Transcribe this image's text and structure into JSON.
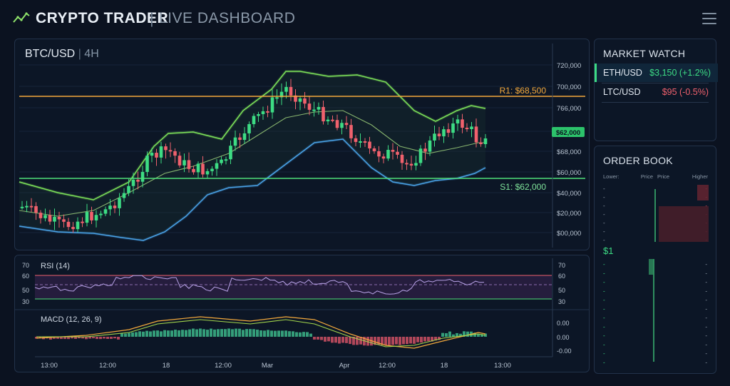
{
  "header": {
    "title": "CRYPTO TRADER",
    "separator": "|",
    "subtitle": "LIVE DASHBOARD",
    "logo_icon": "chart-line-icon",
    "menu_icon": "hamburger-menu-icon"
  },
  "main_chart": {
    "pair": "BTC/USD",
    "separator": "|",
    "timeframe": "4H",
    "price_axis_labels": [
      "720,000",
      "700,000",
      "766,000",
      "$62,000",
      "$68,000",
      "$60,000",
      "$40,000",
      "$20,000",
      "$00,000"
    ],
    "current_price_tag": "$62,000",
    "resistance_label": "R1: $68,500",
    "support_label": "S1: $62,000",
    "colors": {
      "up": "#3ddc84",
      "down": "#f0616d",
      "resistance": "#f3a93c",
      "support": "#4fe07a",
      "band_upper": "#7ee35a",
      "band_lower": "#4aa3e8"
    }
  },
  "indicators": {
    "rsi": {
      "label": "RSI (14)",
      "left_ticks": [
        "70",
        "60",
        "50",
        "30"
      ],
      "right_ticks": [
        "70",
        "60",
        "50",
        "30"
      ]
    },
    "macd": {
      "label": "MACD (12, 26, 9)",
      "right_ticks": [
        "0.00",
        "0.00",
        "-0.00"
      ]
    },
    "x_axis_labels": [
      "13:00",
      "12:00",
      "18",
      "12:00",
      "Mar",
      "Apr",
      "12:00",
      "18",
      "13:00"
    ]
  },
  "market_watch": {
    "title": "MARKET WATCH",
    "items": [
      {
        "symbol": "ETH/USD",
        "value": "$3,150 (+1.2%)",
        "color": "#3ddc84"
      },
      {
        "symbol": "LTC/USD",
        "value": "$95 (-0.5%)",
        "color": "#f0616d"
      }
    ]
  },
  "order_book": {
    "title": "ORDER BOOK",
    "col_lower": "Lower:",
    "col_price_left": "Price",
    "col_price_right": "Price",
    "col_higher": "Higher",
    "mid_price": "$1",
    "row_dash": "-"
  }
}
